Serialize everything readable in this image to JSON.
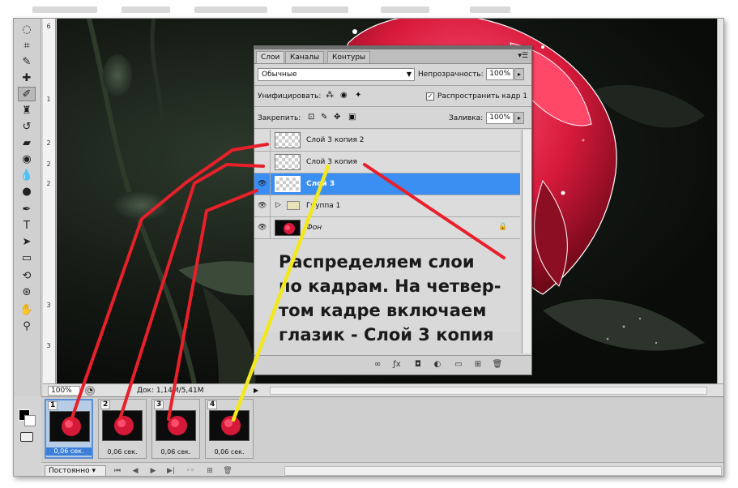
{
  "layers_panel": {
    "tabs": [
      "Слои",
      "Каналы",
      "Контуры"
    ],
    "blend_mode": "Обычные",
    "opacity_label": "Непрозрачность:",
    "opacity_value": "100%",
    "unify_label": "Унифицировать:",
    "propagate_label": "Распространить кадр 1",
    "lock_label": "Закрепить:",
    "fill_label": "Заливка:",
    "fill_value": "100%",
    "layers": [
      {
        "name": "Слой 3 копия 2",
        "visible": false,
        "selected": false,
        "type": "layer"
      },
      {
        "name": "Слой 3 копия",
        "visible": false,
        "selected": false,
        "type": "layer"
      },
      {
        "name": "Слой 3",
        "visible": true,
        "selected": true,
        "type": "layer"
      },
      {
        "name": "Группа 1",
        "visible": true,
        "selected": false,
        "type": "group"
      },
      {
        "name": "Фон",
        "visible": true,
        "selected": false,
        "type": "background"
      }
    ]
  },
  "status_bar": {
    "zoom": "100%",
    "doc_info": "Док: 1,14M/5,41M"
  },
  "animation": {
    "frames": [
      {
        "number": "1",
        "delay": "0,06 сек.",
        "selected": true
      },
      {
        "number": "2",
        "delay": "0,06 сек.",
        "selected": false
      },
      {
        "number": "3",
        "delay": "0,06 сек.",
        "selected": false
      },
      {
        "number": "4",
        "delay": "0,06 сек.",
        "selected": false
      }
    ],
    "loop": "Постоянно"
  },
  "annotation": {
    "lines": [
      "Распределяем слои",
      "по кадрам. На четвер-",
      "том кадре включаем",
      "глазик - Слой 3 копия"
    ]
  },
  "ruler_ticks": [
    "6",
    "1",
    "2",
    "2",
    "2",
    "3",
    "3"
  ],
  "colors": {
    "selection": "#3b8ef2",
    "annotation_red": "#e8202a",
    "annotation_yellow": "#f2e81c"
  }
}
